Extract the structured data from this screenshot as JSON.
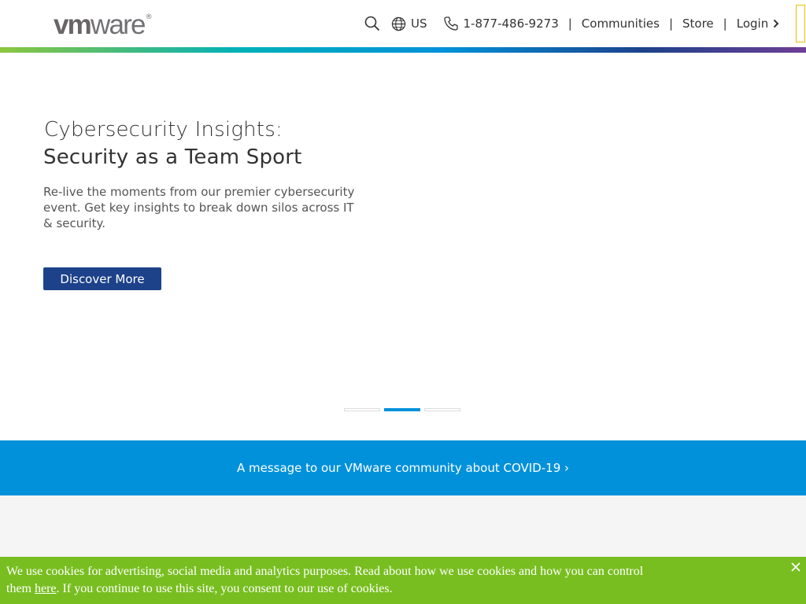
{
  "header": {
    "logo_text_bold": "vm",
    "logo_text_light": "ware",
    "logo_reg": "®",
    "nav": {
      "region": "US",
      "phone": "1-877-486-9273",
      "communities": "Communities",
      "store": "Store",
      "login": "Login",
      "separator": "|"
    }
  },
  "hero": {
    "title_line1": "Cybersecurity Insights:",
    "title_line2": "Security as a Team Sport",
    "description": "Re-live the moments from our premier cybersecurity event. Get key insights to break down silos across IT & security.",
    "cta_label": "Discover More",
    "slides_count": 3,
    "active_slide": 2
  },
  "covid_banner": {
    "text": "A message to our VMware community about COVID-19 ›"
  },
  "cookie_banner": {
    "text_before_link": "We use cookies for advertising, social media and analytics purposes. Read about how we use cookies and how you can control them ",
    "link_text": "here",
    "text_after_link": ". If you continue to use this site, you consent to our use of cookies.",
    "close_symbol": "✕"
  },
  "colors": {
    "brand_blue": "#1d428a",
    "accent_blue": "#0091da",
    "cookie_green": "#78be20"
  },
  "icons": {
    "search": "search-icon",
    "globe": "globe-icon",
    "phone": "phone-icon",
    "chevron": "chevron-right-icon",
    "close": "close-icon"
  }
}
